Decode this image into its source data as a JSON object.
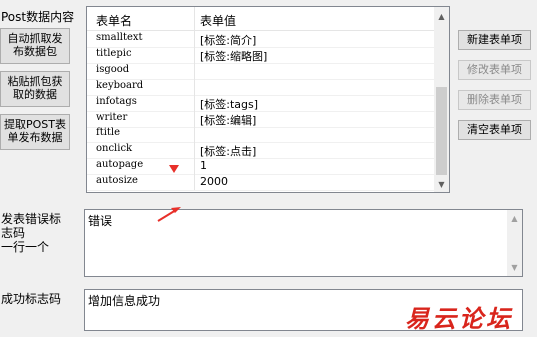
{
  "labels": {
    "post_data": "Post数据内容",
    "error_flag": "发表错误标\n志码\n一行一个",
    "success_flag": "成功标志码"
  },
  "left_buttons": {
    "auto_fetch": "自动抓取发\n布数据包",
    "paste_fetch": "粘贴抓包获\n取的数据",
    "extract_post": "提取POST表\n单发布数据"
  },
  "right_buttons": {
    "new_item": "新建表单项",
    "edit_item": "修改表单项",
    "delete_item": "删除表单项",
    "clear_items": "清空表单项"
  },
  "table": {
    "columns": [
      "表单名",
      "表单值"
    ],
    "rows": [
      {
        "name": "smalltext",
        "value": "[标签:简介]"
      },
      {
        "name": "titlepic",
        "value": "[标签:缩略图]"
      },
      {
        "name": "isgood",
        "value": ""
      },
      {
        "name": "keyboard",
        "value": ""
      },
      {
        "name": "infotags",
        "value": "[标签:tags]"
      },
      {
        "name": "writer",
        "value": "[标签:编辑]"
      },
      {
        "name": "ftitle",
        "value": ""
      },
      {
        "name": "onclick",
        "value": "[标签:点击]"
      },
      {
        "name": "autopage",
        "value": "1"
      },
      {
        "name": "autosize",
        "value": "2000"
      }
    ]
  },
  "error_text": "错误",
  "success_text": "增加信息成功",
  "watermark": "易云论坛",
  "colors": {
    "annotation": "#e8302a",
    "watermark": "#d9251c"
  }
}
